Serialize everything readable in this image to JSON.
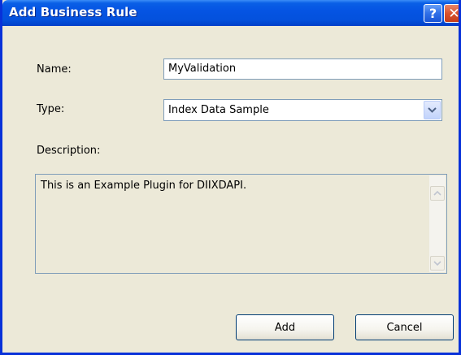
{
  "window": {
    "title": "Add Business Rule",
    "help_glyph": "?",
    "close_glyph": "✕"
  },
  "form": {
    "name_label": "Name:",
    "name_value": "MyValidation",
    "type_label": "Type:",
    "type_value": "Index Data Sample",
    "description_label": "Description:",
    "description_text": "This is an Example Plugin for DIIXDAPI."
  },
  "buttons": {
    "add_label": "Add",
    "cancel_label": "Cancel"
  },
  "icons": {
    "help": "help-icon",
    "close": "close-icon",
    "dropdown": "chevron-down-icon",
    "scroll_up": "scroll-up-icon",
    "scroll_down": "scroll-down-icon"
  },
  "colors": {
    "titlebar": "#0554e3",
    "window_border": "#0831d9",
    "dialog_bg": "#ece9d8",
    "close_button": "#d9522c",
    "field_border": "#7f9db9"
  }
}
